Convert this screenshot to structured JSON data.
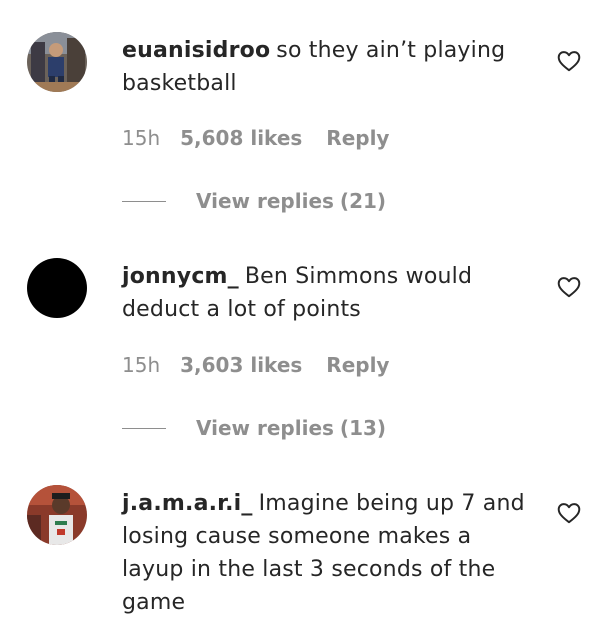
{
  "comments": [
    {
      "username": "euanisidroo",
      "text": "so they ain’t playing basketball",
      "time": "15h",
      "likes": "5,608 likes",
      "reply_label": "Reply",
      "view_replies_label": "View replies",
      "view_replies_count": "(21)",
      "avatar": "photo-avatar"
    },
    {
      "username": "jonnycm_",
      "text": "Ben Simmons would deduct a lot of points",
      "time": "15h",
      "likes": "3,603 likes",
      "reply_label": "Reply",
      "view_replies_label": "View replies",
      "view_replies_count": "(13)",
      "avatar": "black-avatar"
    },
    {
      "username": "j.a.m.a.r.i_",
      "text": "Imagine being up 7 and losing cause someone makes a layup in the last 3 seconds of the game",
      "avatar": "photo-avatar"
    }
  ],
  "icons": {
    "like": "heart-icon"
  },
  "colors": {
    "text": "#262626",
    "secondary": "#8e8e8e",
    "background": "#ffffff"
  }
}
